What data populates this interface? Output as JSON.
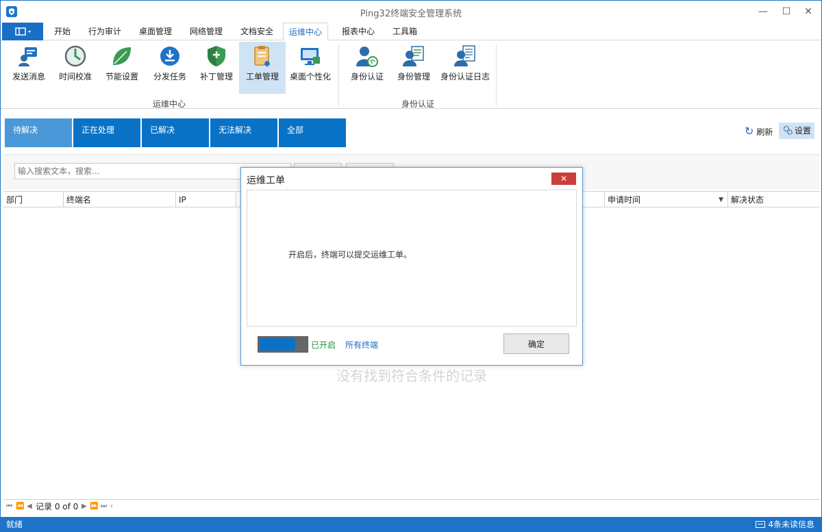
{
  "window": {
    "title": "Ping32终端安全管理系统",
    "minimize": "—",
    "maximize": "☐",
    "close": "✕"
  },
  "menu": {
    "tabs": [
      {
        "label": "开始"
      },
      {
        "label": "行为审计"
      },
      {
        "label": "桌面管理"
      },
      {
        "label": "网络管理"
      },
      {
        "label": "文档安全"
      },
      {
        "label": "运维中心",
        "active": true
      },
      {
        "label": "报表中心"
      },
      {
        "label": "工具箱"
      }
    ]
  },
  "ribbon": {
    "buttons": [
      {
        "label": "发送消息",
        "icon": "send-message-icon"
      },
      {
        "label": "时间校准",
        "icon": "clock-icon"
      },
      {
        "label": "节能设置",
        "icon": "leaf-icon"
      },
      {
        "label": "分发任务",
        "icon": "download-icon"
      },
      {
        "label": "补丁管理",
        "icon": "shield-icon"
      },
      {
        "label": "工单管理",
        "icon": "clipboard-bell-icon",
        "active": true
      },
      {
        "label": "桌面个性化",
        "icon": "monitor-icon"
      },
      {
        "label": "身份认证",
        "icon": "user-fingerprint-icon"
      },
      {
        "label": "身份管理",
        "icon": "user-list-icon"
      },
      {
        "label": "身份认证日志",
        "icon": "user-log-icon"
      }
    ],
    "groups": [
      {
        "label": "运维中心"
      },
      {
        "label": "身份认证"
      }
    ]
  },
  "filters": {
    "tabs": [
      {
        "label": "待解决",
        "active": true
      },
      {
        "label": "正在处理"
      },
      {
        "label": "已解决"
      },
      {
        "label": "无法解决"
      },
      {
        "label": "全部"
      }
    ],
    "refresh_label": "刷新",
    "settings_label": "设置"
  },
  "search": {
    "placeholder": "输入搜索文本，搜索..."
  },
  "grid": {
    "columns": [
      {
        "label": "部门"
      },
      {
        "label": "终端名"
      },
      {
        "label": "IP"
      },
      {
        "label": "申请时间"
      },
      {
        "label": "解决状态"
      }
    ],
    "empty_text": "没有找到符合条件的记录"
  },
  "pager": {
    "text": "记录 0 of 0"
  },
  "status": {
    "left": "就绪",
    "right": "4条未读信息"
  },
  "dialog": {
    "title": "运维工单",
    "close": "✕",
    "message": "开启后，终端可以提交运维工单。",
    "toggle_state": "已开启",
    "toggle_on": true,
    "scope_link": "所有终端",
    "ok_label": "确定"
  },
  "colors": {
    "accent": "#1e73c8",
    "tab_blue": "#0a72c6",
    "tab_active": "#4b98d8",
    "close_red": "#c9403a",
    "enabled_green": "#1f9a3a"
  }
}
